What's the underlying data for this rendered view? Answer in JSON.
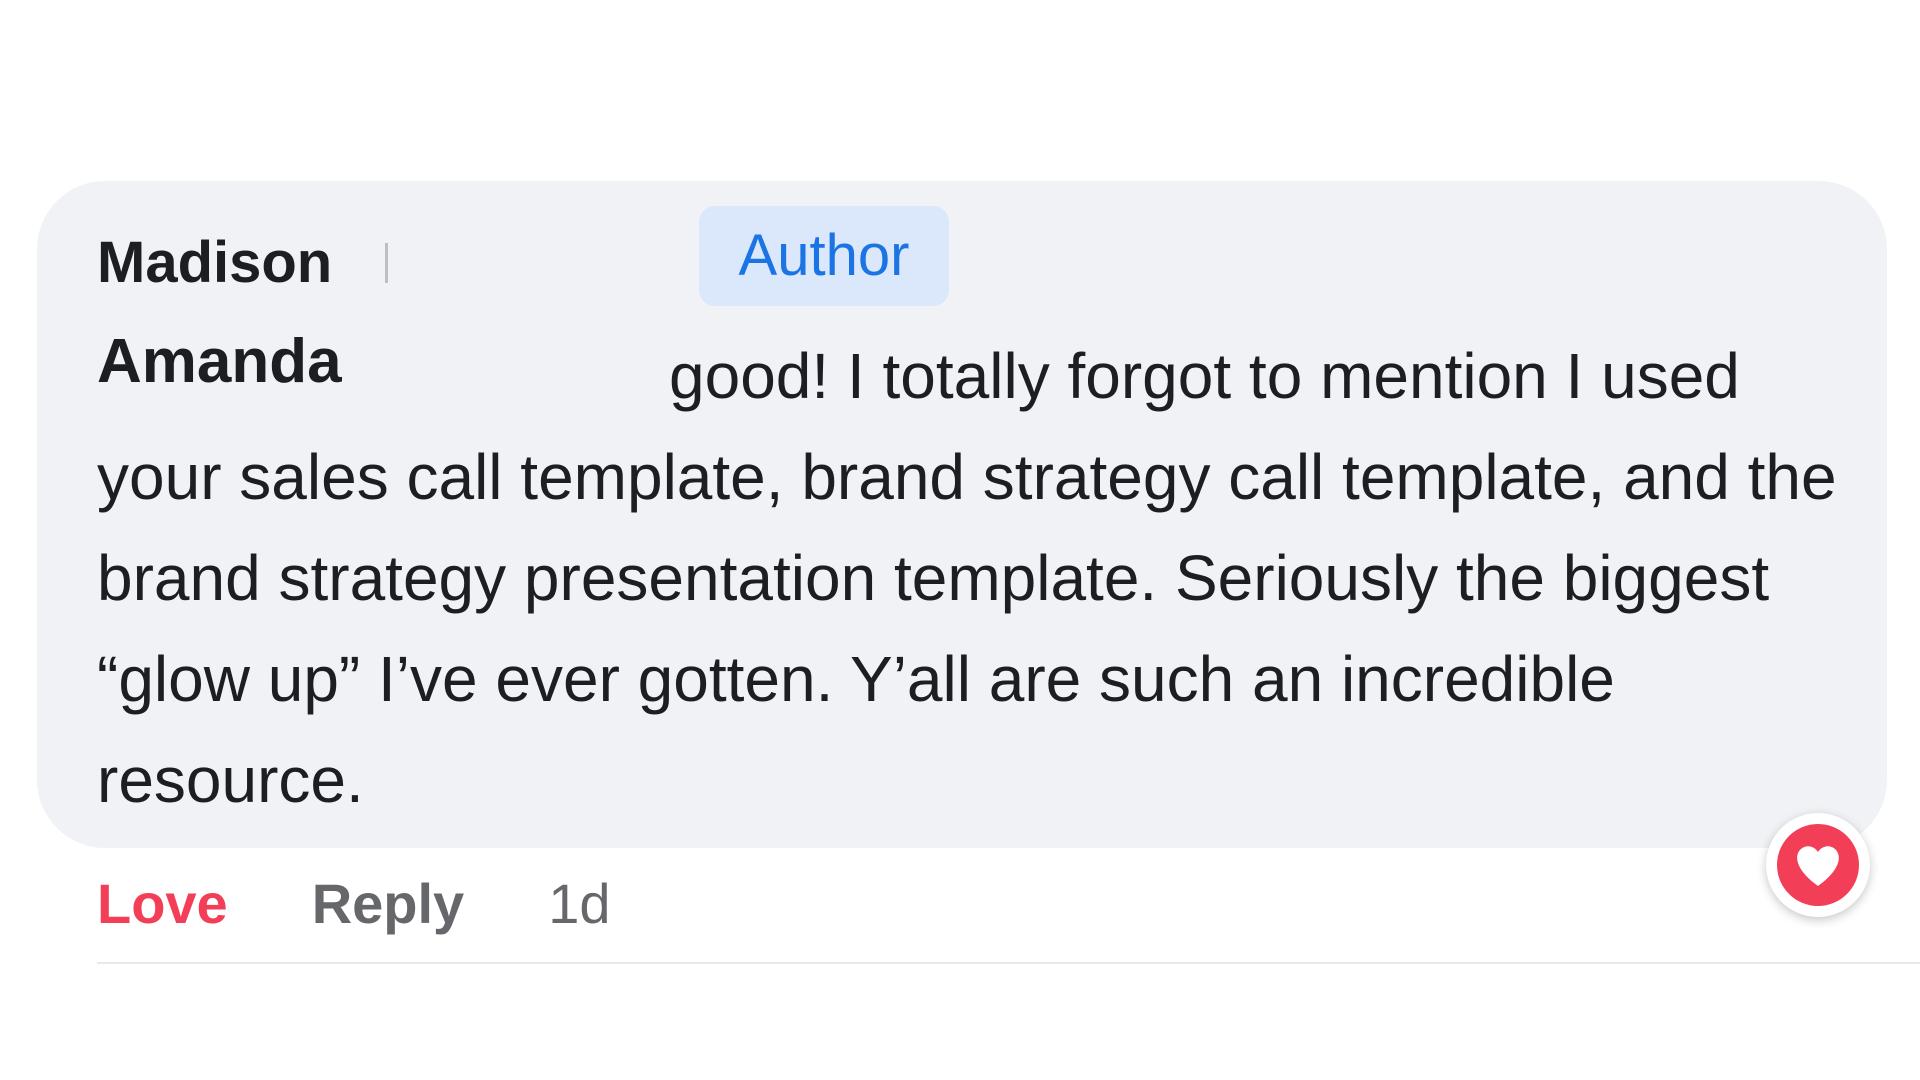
{
  "comment": {
    "author_first": "Madison",
    "author_badge": "Author",
    "author_second": "Amanda",
    "text": "good! I totally forgot to mention I used your sales call template, brand strategy call template, and the brand strategy presentation template. Seriously the biggest “glow up” I’ve ever gotten. Y’all are such an incredible resource."
  },
  "actions": {
    "love_label": "Love",
    "reply_label": "Reply",
    "timestamp": "1d"
  },
  "reaction": {
    "icon": "heart-icon",
    "color": "#f33e58"
  },
  "colors": {
    "bubble_bg": "#f0f2f5",
    "love_red": "#f33e58",
    "badge_bg": "#dbe7fb",
    "badge_text": "#1b74e4",
    "secondary_text": "#65676b"
  }
}
